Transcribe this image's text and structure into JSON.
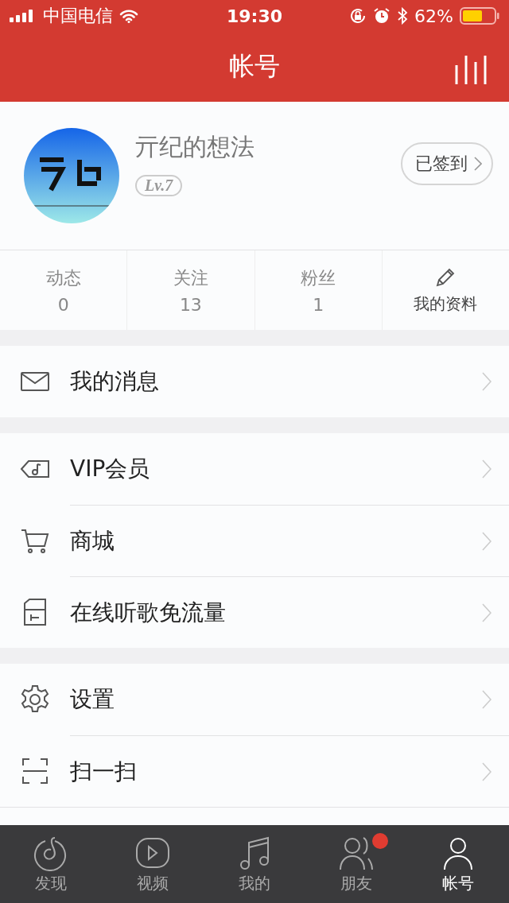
{
  "status_bar": {
    "carrier": "中国电信",
    "time": "19:30",
    "battery": "62%"
  },
  "header": {
    "title": "帐号"
  },
  "profile": {
    "name": "亓纪的想法",
    "level": "Lv.7",
    "checkin": "已签到"
  },
  "stats": [
    {
      "label": "动态",
      "value": "0"
    },
    {
      "label": "关注",
      "value": "13"
    },
    {
      "label": "粉丝",
      "value": "1"
    }
  ],
  "edit_profile": "我的资料",
  "menu_groups": [
    [
      {
        "kind": "mail",
        "label": "我的消息"
      }
    ],
    [
      {
        "kind": "vip",
        "label": "VIP会员"
      },
      {
        "kind": "cart",
        "label": "商城"
      },
      {
        "kind": "sim",
        "label": "在线听歌免流量"
      }
    ],
    [
      {
        "kind": "gear",
        "label": "设置"
      },
      {
        "kind": "scan",
        "label": "扫一扫"
      }
    ]
  ],
  "tabs": [
    {
      "kind": "discover",
      "label": "发现",
      "selected": false,
      "badge": false
    },
    {
      "kind": "video",
      "label": "视频",
      "selected": false,
      "badge": false
    },
    {
      "kind": "music",
      "label": "我的",
      "selected": false,
      "badge": false
    },
    {
      "kind": "friends",
      "label": "朋友",
      "selected": false,
      "badge": true
    },
    {
      "kind": "account",
      "label": "帐号",
      "selected": true,
      "badge": false
    }
  ]
}
